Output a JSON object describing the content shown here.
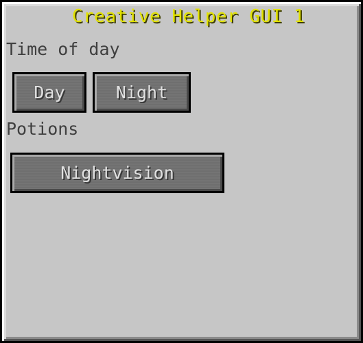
{
  "gui": {
    "title": "Creative Helper GUI 1"
  },
  "sections": {
    "time_of_day": {
      "label": "Time of day",
      "buttons": {
        "day": "Day",
        "night": "Night"
      }
    },
    "potions": {
      "label": "Potions",
      "buttons": {
        "nightvision": "Nightvision"
      }
    }
  },
  "colors": {
    "panel_background": "#c6c6c6",
    "title_text": "#e2e200",
    "label_text": "#3f3f3f",
    "button_face": "#6f6f6f",
    "button_text": "#e0e0e0"
  }
}
